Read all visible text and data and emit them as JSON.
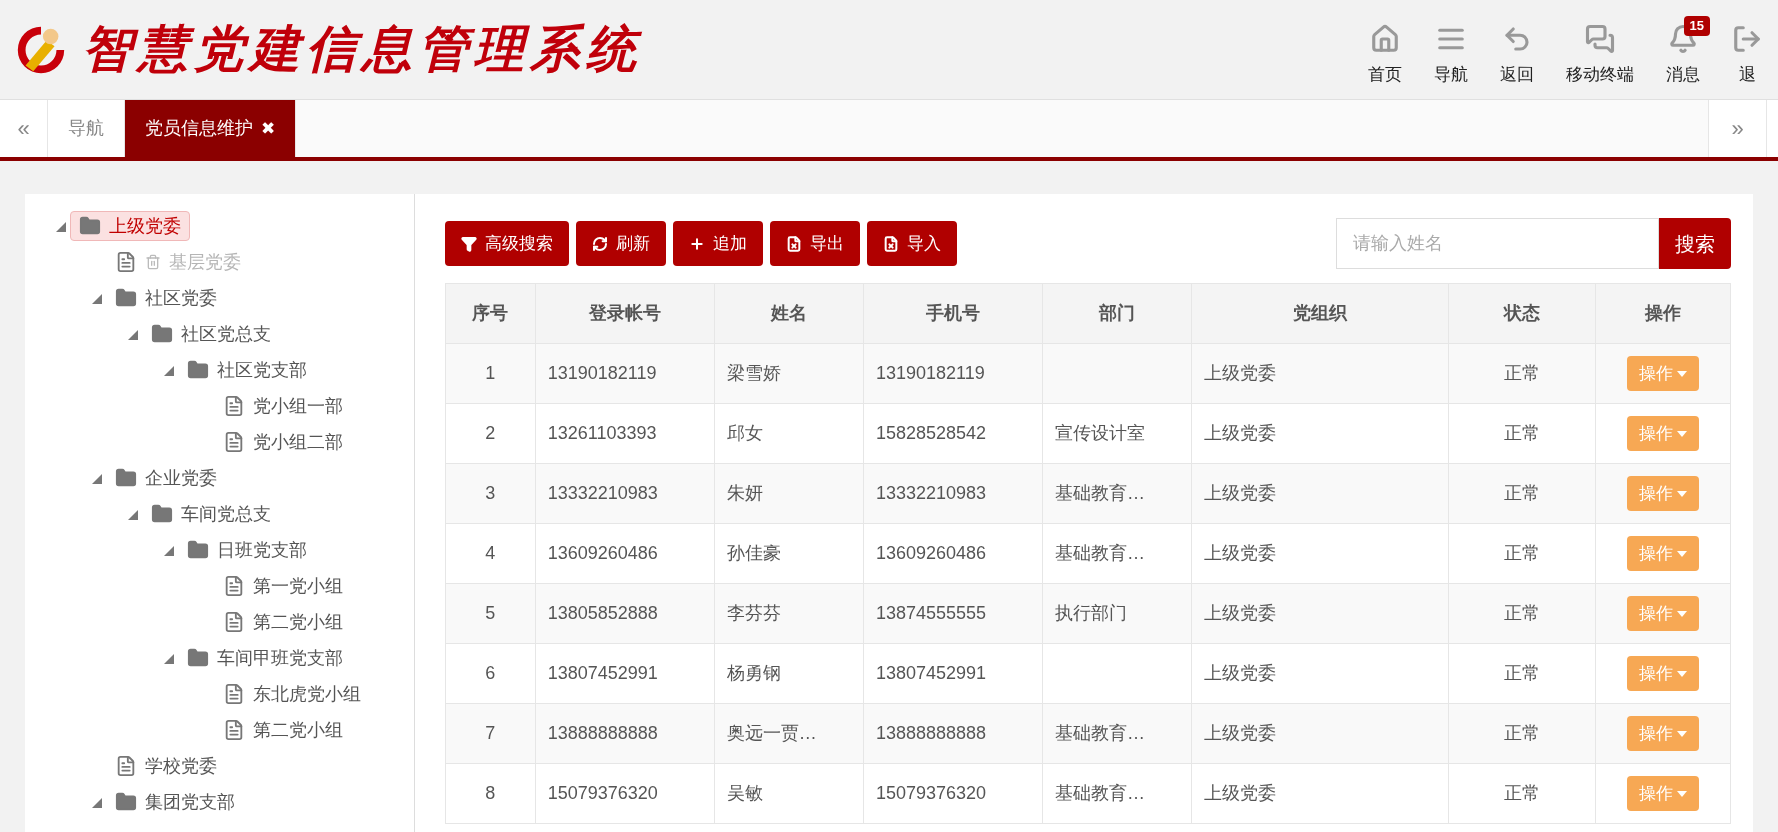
{
  "header": {
    "title": "智慧党建信息管理系统",
    "actions": [
      {
        "kind": "home",
        "label": "首页"
      },
      {
        "kind": "menu",
        "label": "导航"
      },
      {
        "kind": "back",
        "label": "返回"
      },
      {
        "kind": "chat",
        "label": "移动终端"
      },
      {
        "kind": "bell",
        "label": "消息",
        "badge": "15"
      },
      {
        "kind": "exit",
        "label": "退"
      }
    ]
  },
  "tabbar": {
    "prev": "«",
    "next": "»",
    "tabs": [
      {
        "label": "导航",
        "selected": false,
        "closable": false
      },
      {
        "label": "党员信息维护",
        "selected": true,
        "closable": true,
        "close": "✖"
      }
    ]
  },
  "tree": [
    {
      "label": "上级党委",
      "kind": "folder",
      "expanded": true,
      "selected": true,
      "disabled": false,
      "children": [
        {
          "label": "基层党委",
          "kind": "file",
          "selected": false,
          "disabled": true
        },
        {
          "label": "社区党委",
          "kind": "folder",
          "expanded": true,
          "selected": false,
          "disabled": false,
          "children": [
            {
              "label": "社区党总支",
              "kind": "folder",
              "expanded": true,
              "selected": false,
              "disabled": false,
              "children": [
                {
                  "label": "社区党支部",
                  "kind": "folder",
                  "expanded": true,
                  "selected": false,
                  "disabled": false,
                  "children": [
                    {
                      "label": "党小组一部",
                      "kind": "file",
                      "selected": false,
                      "disabled": false
                    },
                    {
                      "label": "党小组二部",
                      "kind": "file",
                      "selected": false,
                      "disabled": false
                    }
                  ]
                }
              ]
            }
          ]
        },
        {
          "label": "企业党委",
          "kind": "folder",
          "expanded": true,
          "selected": false,
          "disabled": false,
          "children": [
            {
              "label": "车间党总支",
              "kind": "folder",
              "expanded": true,
              "selected": false,
              "disabled": false,
              "children": [
                {
                  "label": "日班党支部",
                  "kind": "folder",
                  "expanded": true,
                  "selected": false,
                  "disabled": false,
                  "children": [
                    {
                      "label": "第一党小组",
                      "kind": "file",
                      "selected": false,
                      "disabled": false
                    },
                    {
                      "label": "第二党小组",
                      "kind": "file",
                      "selected": false,
                      "disabled": false
                    }
                  ]
                },
                {
                  "label": "车间甲班党支部",
                  "kind": "folder",
                  "expanded": true,
                  "selected": false,
                  "disabled": false,
                  "children": [
                    {
                      "label": "东北虎党小组",
                      "kind": "file",
                      "selected": false,
                      "disabled": false
                    },
                    {
                      "label": "第二党小组",
                      "kind": "file",
                      "selected": false,
                      "disabled": false
                    }
                  ]
                }
              ]
            }
          ]
        },
        {
          "label": "学校党委",
          "kind": "file",
          "selected": false,
          "disabled": false
        },
        {
          "label": "集团党支部",
          "kind": "folder",
          "expanded": true,
          "selected": false,
          "disabled": false
        }
      ]
    }
  ],
  "toolbar": [
    {
      "kind": "filter",
      "label": "高级搜索"
    },
    {
      "kind": "refresh",
      "label": "刷新"
    },
    {
      "kind": "add",
      "label": "追加"
    },
    {
      "kind": "excel",
      "label": "导出"
    },
    {
      "kind": "excel",
      "label": "导入"
    }
  ],
  "search": {
    "placeholder": "请输入姓名",
    "button": "搜索"
  },
  "table": {
    "columns": [
      "序号",
      "登录帐号",
      "姓名",
      "手机号",
      "部门",
      "党组织",
      "状态",
      "操作"
    ],
    "rows": [
      [
        "1",
        "13190182119",
        "梁雪娇",
        "13190182119",
        "",
        "上级党委",
        "正常",
        "操作"
      ],
      [
        "2",
        "13261103393",
        "邱女",
        "15828528542",
        "宣传设计室",
        "上级党委",
        "正常",
        "操作"
      ],
      [
        "3",
        "13332210983",
        "朱妍",
        "13332210983",
        "基础教育…",
        "上级党委",
        "正常",
        "操作"
      ],
      [
        "4",
        "13609260486",
        "孙佳豪",
        "13609260486",
        "基础教育…",
        "上级党委",
        "正常",
        "操作"
      ],
      [
        "5",
        "13805852888",
        "李芬芬",
        "13874555555",
        "执行部门",
        "上级党委",
        "正常",
        "操作"
      ],
      [
        "6",
        "13807452991",
        "杨勇钢",
        "13807452991",
        "",
        "上级党委",
        "正常",
        "操作"
      ],
      [
        "7",
        "13888888888",
        "奥远一贾…",
        "13888888888",
        "基础教育…",
        "上级党委",
        "正常",
        "操作"
      ],
      [
        "8",
        "15079376320",
        "吴敏",
        "15079376320",
        "基础教育…",
        "上级党委",
        "正常",
        "操作"
      ]
    ]
  }
}
